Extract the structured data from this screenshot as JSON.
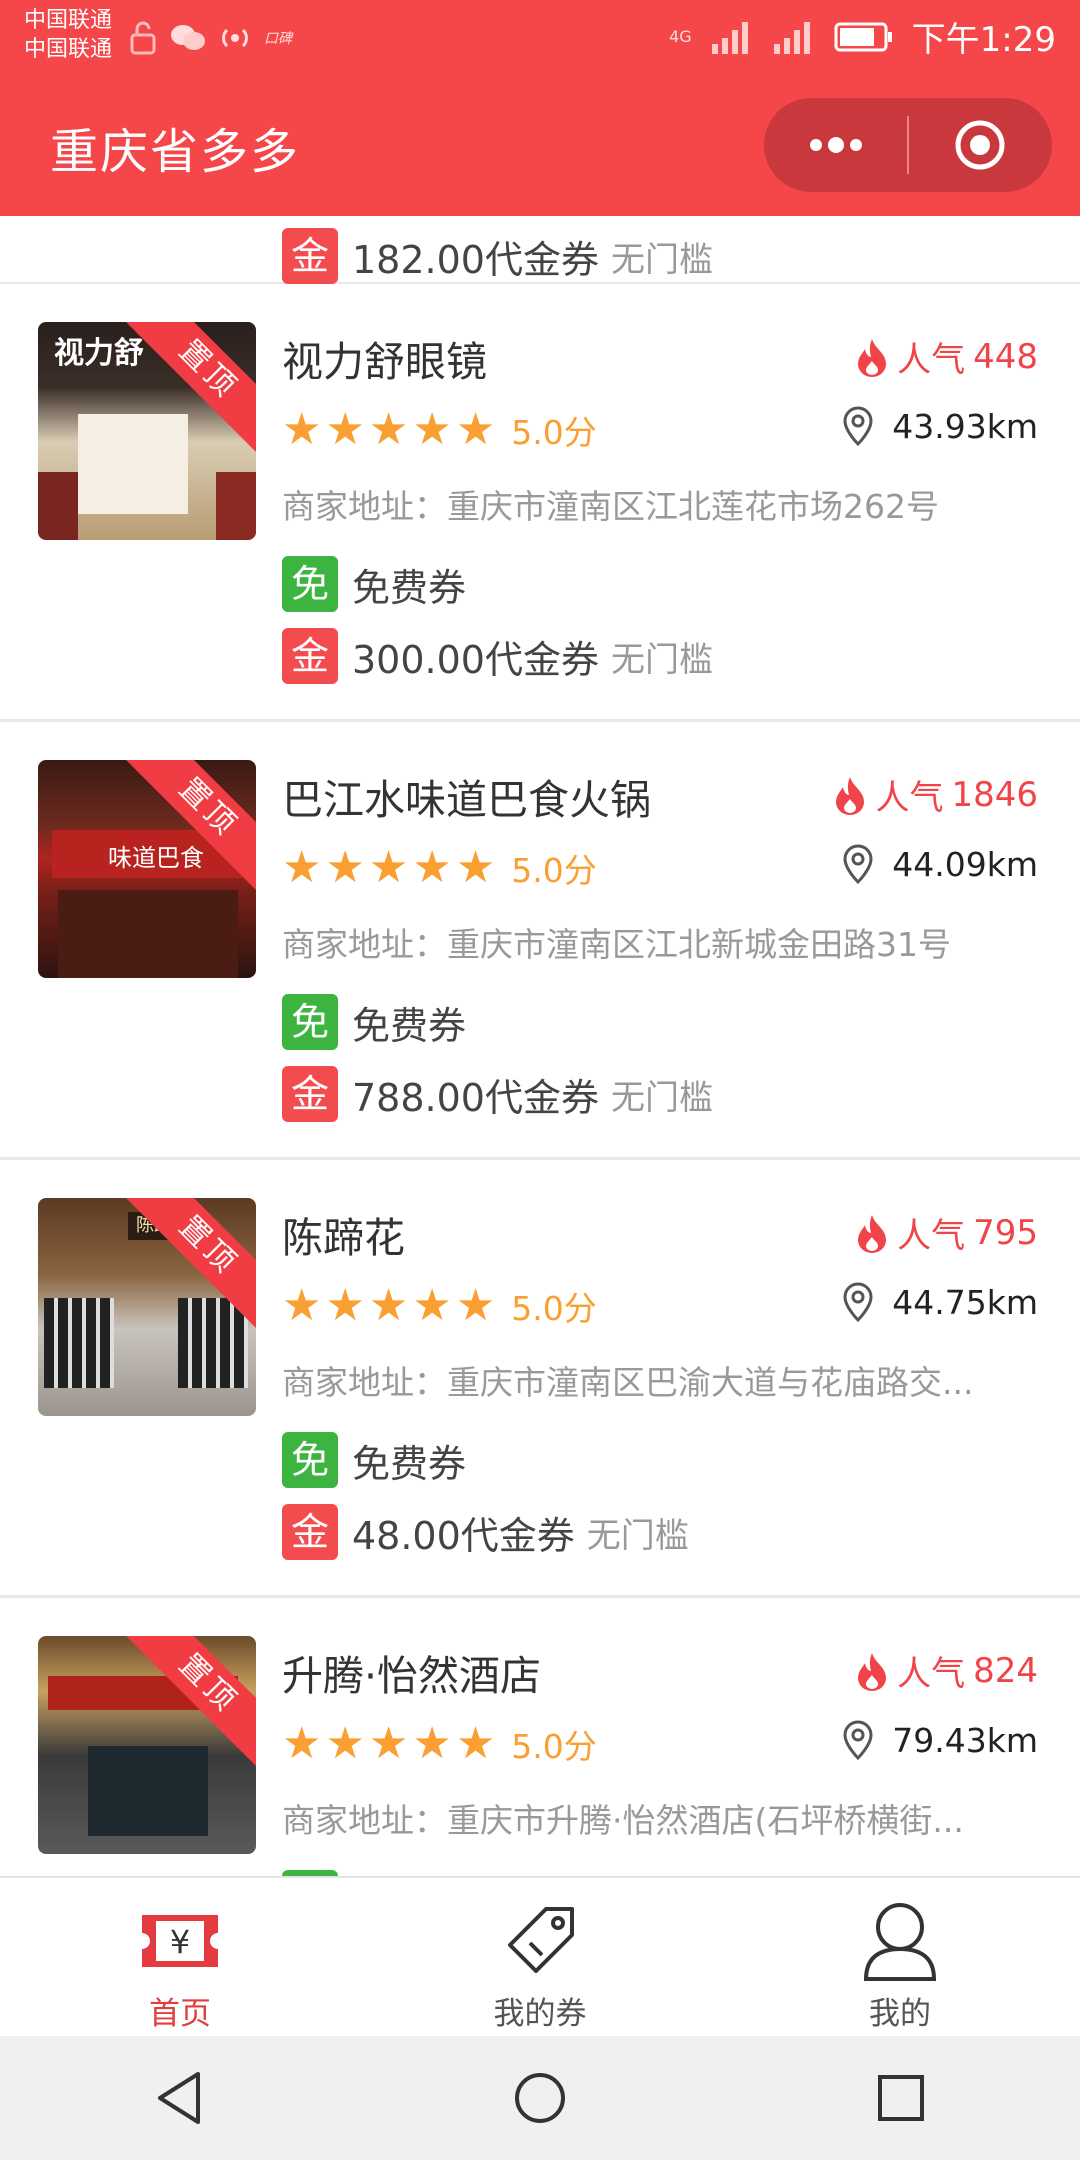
{
  "status_bar": {
    "carrier_1": "中国联通",
    "carrier_2": "中国联通",
    "network": "4G",
    "time": "下午1:29"
  },
  "header": {
    "title": "重庆省多多",
    "more_icon": "more-dots-icon",
    "close_icon": "target-circle-icon"
  },
  "colors": {
    "brand": "#f5464a",
    "star": "#fa9f32",
    "free": "#3db340",
    "gold": "#f34c4f"
  },
  "top_partial": {
    "voucher_value": "182.00代金券",
    "voucher_note": "无门槛"
  },
  "listings": [
    {
      "name": "视力舒眼镜",
      "popularity_label": "人气",
      "popularity": "448",
      "rating": 5,
      "score": "5.0分",
      "distance": "43.93km",
      "address_prefix": "商家地址：",
      "address": "重庆市潼南区江北莲花市场262号",
      "free_badge": "免",
      "free_label": "免费券",
      "gold_badge": "金",
      "voucher": "300.00代金券",
      "voucher_note": "无门槛",
      "ribbon": "置顶"
    },
    {
      "name": "巴江水味道巴食火锅",
      "popularity_label": "人气",
      "popularity": "1846",
      "rating": 5,
      "score": "5.0分",
      "distance": "44.09km",
      "address_prefix": "商家地址：",
      "address": "重庆市潼南区江北新城金田路31号",
      "free_badge": "免",
      "free_label": "免费券",
      "gold_badge": "金",
      "voucher": "788.00代金券",
      "voucher_note": "无门槛",
      "ribbon": "置顶"
    },
    {
      "name": "陈蹄花",
      "popularity_label": "人气",
      "popularity": "795",
      "rating": 5,
      "score": "5.0分",
      "distance": "44.75km",
      "address_prefix": "商家地址：",
      "address": "重庆市潼南区巴渝大道与花庙路交...",
      "free_badge": "免",
      "free_label": "免费券",
      "gold_badge": "金",
      "voucher": "48.00代金券",
      "voucher_note": "无门槛",
      "ribbon": "置顶"
    },
    {
      "name": "升腾·怡然酒店",
      "popularity_label": "人气",
      "popularity": "824",
      "rating": 5,
      "score": "5.0分",
      "distance": "79.43km",
      "address_prefix": "商家地址：",
      "address": "重庆市升腾·怡然酒店(石坪桥横街...",
      "ribbon": "置顶"
    }
  ],
  "tabs": [
    {
      "label": "首页",
      "icon": "yen-ticket-icon",
      "active": true
    },
    {
      "label": "我的券",
      "icon": "price-tag-icon",
      "active": false
    },
    {
      "label": "我的",
      "icon": "user-icon",
      "active": false
    }
  ],
  "system_nav": [
    "back-icon",
    "home-icon",
    "recents-icon"
  ]
}
